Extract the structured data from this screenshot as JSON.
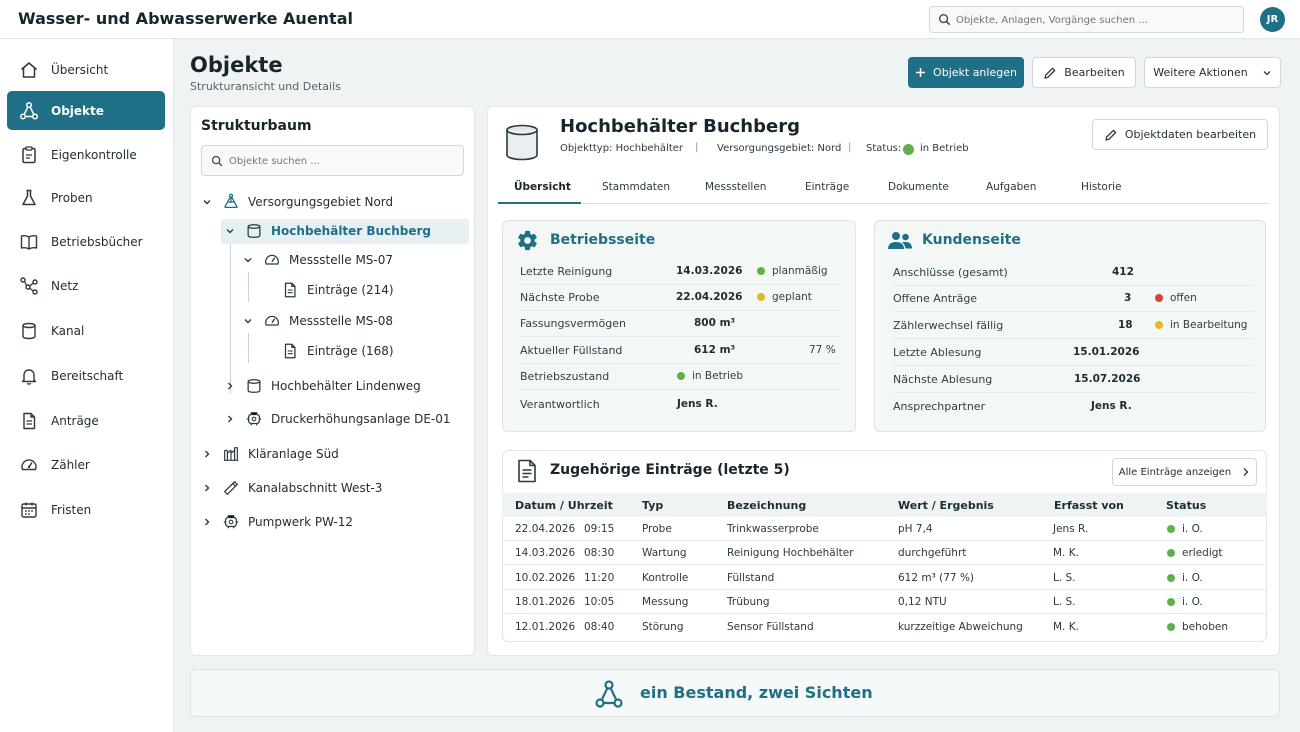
{
  "header": {
    "app_title": "Wasser- und Abwasserwerke Auental",
    "search_placeholder": "Objekte, Anlagen, Vorgänge suchen ...",
    "avatar_initials": "JR"
  },
  "sidebar": {
    "items": [
      {
        "label": "Übersicht",
        "icon": "home-icon",
        "active": false
      },
      {
        "label": "Objekte",
        "icon": "network-icon",
        "active": true
      },
      {
        "label": "Eigenkontrolle",
        "icon": "clipboard-icon",
        "active": false
      },
      {
        "label": "Proben",
        "icon": "flask-icon",
        "active": false
      },
      {
        "label": "Betriebsbücher",
        "icon": "book-icon",
        "active": false
      },
      {
        "label": "Netz",
        "icon": "graph-icon",
        "active": false
      },
      {
        "label": "Kanal",
        "icon": "cylinder-icon",
        "active": false
      },
      {
        "label": "Bereitschaft",
        "icon": "bell-icon",
        "active": false
      },
      {
        "label": "Anträge",
        "icon": "document-icon",
        "active": false
      },
      {
        "label": "Zähler",
        "icon": "gauge-icon",
        "active": false
      },
      {
        "label": "Fristen",
        "icon": "calendar-icon",
        "active": false
      }
    ]
  },
  "page": {
    "title": "Objekte",
    "subtitle": "Strukturansicht und Details",
    "btn_new": "Objekt anlegen",
    "btn_edit": "Bearbeiten",
    "btn_more": "Weitere Aktionen"
  },
  "tree": {
    "title": "Strukturbaum",
    "search_placeholder": "Objekte suchen ...",
    "nodes": [
      {
        "label": "Versorgungsgebiet Nord",
        "icon": "network-icon",
        "expanded": true
      },
      {
        "label": "Hochbehälter Buchberg",
        "icon": "tank-icon",
        "expanded": true,
        "selected": true
      },
      {
        "label": "Messstelle MS-07",
        "icon": "gauge-icon",
        "expanded": true
      },
      {
        "label": "Einträge (214)",
        "icon": "document-icon"
      },
      {
        "label": "Messstelle MS-08",
        "icon": "gauge-icon",
        "expanded": true
      },
      {
        "label": "Einträge (168)",
        "icon": "document-icon"
      },
      {
        "label": "Hochbehälter Lindenweg",
        "icon": "tank-icon",
        "expanded": false
      },
      {
        "label": "Druckerhöhungsanlage DE-01",
        "icon": "pump-icon",
        "expanded": false
      },
      {
        "label": "Kläranlage Süd",
        "icon": "plant-icon",
        "expanded": false
      },
      {
        "label": "Kanalabschnitt West-3",
        "icon": "pipe-icon",
        "expanded": false
      },
      {
        "label": "Pumpwerk PW-12",
        "icon": "pump-icon",
        "expanded": false
      }
    ]
  },
  "detail": {
    "title": "Hochbehälter Buchberg",
    "type_label": "Objekttyp: Hochbehälter",
    "area_label": "Versorgungsgebiet: Nord",
    "status_prefix": "Status:",
    "status_value": "in Betrieb",
    "btn_edit_data": "Objektdaten bearbeiten",
    "tabs": [
      "Übersicht",
      "Stammdaten",
      "Messstellen",
      "Einträge",
      "Dokumente",
      "Aufgaben",
      "Historie"
    ],
    "active_tab": "Übersicht"
  },
  "betrieb": {
    "title": "Betriebsseite",
    "rows": [
      {
        "key": "Letzte Reinigung",
        "value": "14.03.2026",
        "status": "planmäßig",
        "status_color": "#5fb04a"
      },
      {
        "key": "Nächste Probe",
        "value": "22.04.2026",
        "status": "geplant",
        "status_color": "#e8b524"
      },
      {
        "key": "Fassungsvermögen",
        "value": "800 m³",
        "status": "",
        "status_color": ""
      },
      {
        "key": "Aktueller Füllstand",
        "value": "612 m³",
        "status": "77 %",
        "status_color": ""
      },
      {
        "key": "Betriebszustand",
        "value": "",
        "status": "in Betrieb",
        "status_color": "#5fb04a"
      },
      {
        "key": "Verantwortlich",
        "value": "Jens R.",
        "status": "",
        "status_color": ""
      }
    ]
  },
  "kunden": {
    "title": "Kundenseite",
    "rows": [
      {
        "key": "Anschlüsse (gesamt)",
        "value": "412",
        "status": "",
        "status_color": ""
      },
      {
        "key": "Offene Anträge",
        "value": "3",
        "status": "offen",
        "status_color": "#d9413b"
      },
      {
        "key": "Zählerwechsel fällig",
        "value": "18",
        "status": "in Bearbeitung",
        "status_color": "#e8b524"
      },
      {
        "key": "Letzte Ablesung",
        "value": "15.01.2026",
        "status": "",
        "status_color": ""
      },
      {
        "key": "Nächste Ablesung",
        "value": "15.07.2026",
        "status": "",
        "status_color": ""
      },
      {
        "key": "Ansprechpartner",
        "value": "Jens R.",
        "status": "",
        "status_color": ""
      }
    ]
  },
  "entries": {
    "title": "Zugehörige Einträge (letzte 5)",
    "btn_all": "Alle Einträge anzeigen",
    "columns": [
      "Datum / Uhrzeit",
      "Typ",
      "Bezeichnung",
      "Wert / Ergebnis",
      "Erfasst von",
      "Status"
    ],
    "rows": [
      {
        "date": "22.04.2026",
        "time": "09:15",
        "type": "Probe",
        "name": "Trinkwasserprobe",
        "value": "pH 7,4",
        "by": "Jens R.",
        "status": "i. O."
      },
      {
        "date": "14.03.2026",
        "time": "08:30",
        "type": "Wartung",
        "name": "Reinigung Hochbehälter",
        "value": "durchgeführt",
        "by": "M. K.",
        "status": "erledigt"
      },
      {
        "date": "10.02.2026",
        "time": "11:20",
        "type": "Kontrolle",
        "name": "Füllstand",
        "value": "612 m³ (77 %)",
        "by": "L. S.",
        "status": "i. O."
      },
      {
        "date": "18.01.2026",
        "time": "10:05",
        "type": "Messung",
        "name": "Trübung",
        "value": "0,12 NTU",
        "by": "L. S.",
        "status": "i. O."
      },
      {
        "date": "12.01.2026",
        "time": "08:40",
        "type": "Störung",
        "name": "Sensor Füllstand",
        "value": "kurzzeitige Abweichung",
        "by": "M. K.",
        "status": "behoben"
      }
    ],
    "status_color": "#5fb04a"
  },
  "banner": {
    "text": "ein Bestand, zwei Sichten"
  },
  "colors": {
    "accent": "#1f6f86",
    "ok": "#5fb04a",
    "warn": "#e8b524",
    "error": "#d9413b"
  }
}
